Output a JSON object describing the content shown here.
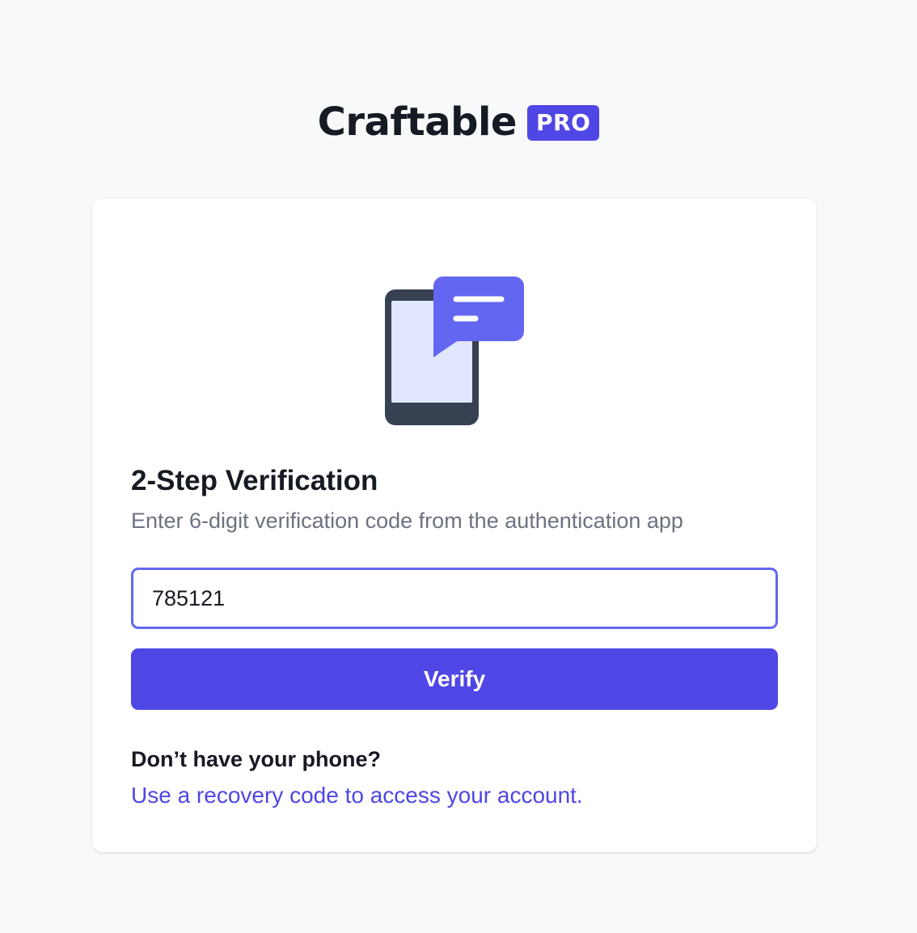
{
  "brand": {
    "name": "Craftable",
    "badge": "PRO",
    "accent_color": "#4f46e5"
  },
  "illustration": {
    "icon": "phone-message-icon"
  },
  "verification": {
    "title": "2-Step Verification",
    "subtitle": "Enter 6-digit verification code from the authentication app",
    "code_value": "785121",
    "verify_label": "Verify"
  },
  "recovery": {
    "question": "Don’t have your phone?",
    "link_text": "Use a recovery code to access your account."
  }
}
